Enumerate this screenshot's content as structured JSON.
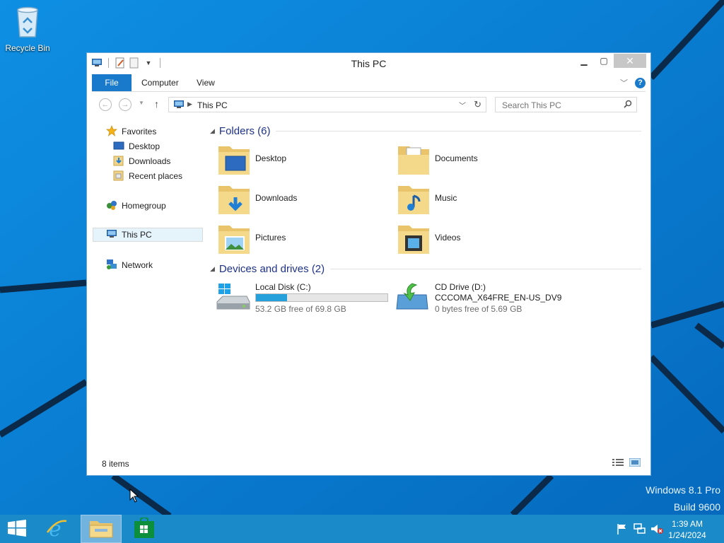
{
  "desktop": {
    "recycle_bin_label": "Recycle Bin"
  },
  "window": {
    "title": "This PC",
    "tabs": {
      "file": "File",
      "computer": "Computer",
      "view": "View"
    },
    "address": "This PC",
    "search_placeholder": "Search This PC",
    "nav": {
      "favorites": "Favorites",
      "desktop": "Desktop",
      "downloads": "Downloads",
      "recent": "Recent places",
      "homegroup": "Homegroup",
      "this_pc": "This PC",
      "network": "Network"
    },
    "folders_header": "Folders (6)",
    "folders": [
      {
        "name": "Desktop"
      },
      {
        "name": "Documents"
      },
      {
        "name": "Downloads"
      },
      {
        "name": "Music"
      },
      {
        "name": "Pictures"
      },
      {
        "name": "Videos"
      }
    ],
    "devices_header": "Devices and drives (2)",
    "drives": [
      {
        "name": "Local Disk (C:)",
        "free": "53.2 GB free of 69.8 GB",
        "used_fraction": 0.238
      },
      {
        "name": "CD Drive (D:)",
        "label": "CCCOMA_X64FRE_EN-US_DV9",
        "free": "0 bytes free of 5.69 GB"
      }
    ],
    "status": "8 items"
  },
  "watermark": {
    "line1": "Windows 8.1 Pro",
    "line2": "Build 9600"
  },
  "taskbar": {
    "time": "1:39 AM",
    "date": "1/24/2024"
  },
  "colors": {
    "accent": "#1979ca",
    "taskbar": "#1a8ac9",
    "desktop": "#0a7fd6"
  }
}
